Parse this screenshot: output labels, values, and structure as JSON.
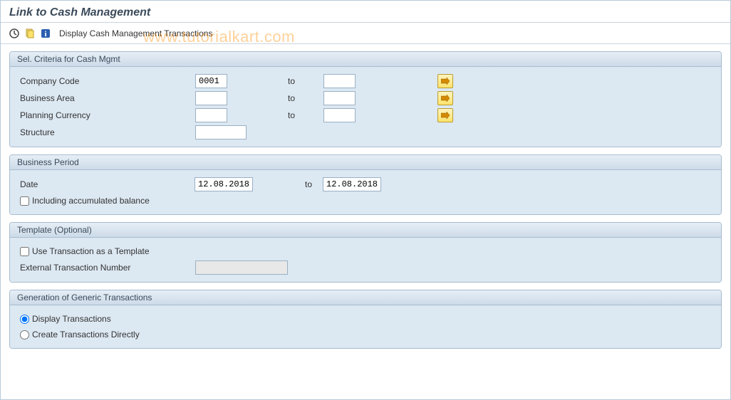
{
  "header": {
    "title": "Link to Cash Management"
  },
  "toolbar": {
    "display_link": "Display Cash Management Transactions"
  },
  "watermark": "www.tutorialkart.com",
  "panel_sel": {
    "title": "Sel. Criteria for Cash Mgmt",
    "company_code_label": "Company Code",
    "company_code_value": "0001",
    "business_area_label": "Business Area",
    "business_area_value": "",
    "planning_currency_label": "Planning Currency",
    "planning_currency_value": "",
    "structure_label": "Structure",
    "structure_value": "",
    "to_label": "to"
  },
  "panel_period": {
    "title": "Business Period",
    "date_label": "Date",
    "date_from": "12.08.2018",
    "date_to": "12.08.2018",
    "to_label": "to",
    "accum_label": "Including accumulated balance"
  },
  "panel_template": {
    "title": "Template (Optional)",
    "use_tmpl_label": "Use Transaction as a Template",
    "ext_txn_label": "External Transaction Number",
    "ext_txn_value": ""
  },
  "panel_gen": {
    "title": "Generation of Generic Transactions",
    "opt_display": "Display Transactions",
    "opt_create": "Create Transactions Directly"
  }
}
